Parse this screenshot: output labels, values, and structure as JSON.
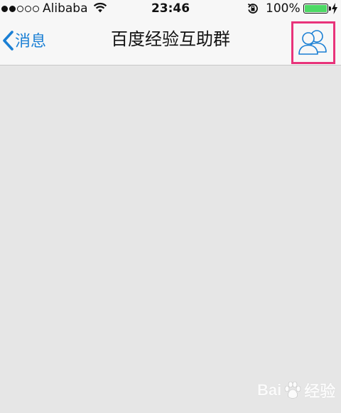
{
  "status_bar": {
    "carrier": "Alibaba",
    "time": "23:46",
    "battery_percent": "100%",
    "battery_level": 1.0,
    "signal_dots_filled": 2,
    "signal_dots_total": 5,
    "battery_color": "#4cd964"
  },
  "nav": {
    "back_label": "消息",
    "title": "百度经验互助群",
    "accent_color": "#1a7fd4",
    "highlight_color": "#e8337a",
    "right_icon": "group-members-icon"
  },
  "content": {
    "background": "#e6e6e6"
  },
  "watermark": {
    "text_left": "Bai",
    "text_right": "经验",
    "icon": "baidu-paw-icon"
  }
}
